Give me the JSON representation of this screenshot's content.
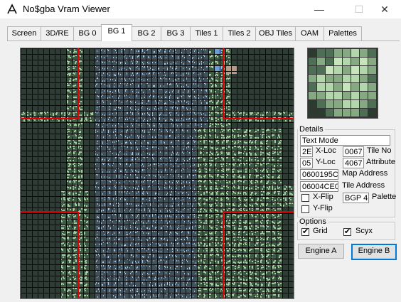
{
  "window": {
    "title": "No$gba Vram Viewer",
    "minimize_glyph": "—",
    "maximize_glyph": "☐",
    "close_glyph": "✕"
  },
  "tabs": [
    {
      "label": "Screen"
    },
    {
      "label": "3D/RE"
    },
    {
      "label": "BG 0"
    },
    {
      "label": "BG 1",
      "active": true
    },
    {
      "label": "BG 2"
    },
    {
      "label": "BG 3"
    },
    {
      "label": "Tiles 1"
    },
    {
      "label": "Tiles 2"
    },
    {
      "label": "OBJ Tiles"
    },
    {
      "label": "OAM"
    },
    {
      "label": "Palettes"
    }
  ],
  "details": {
    "legend": "Details",
    "mode": "Text Mode",
    "x_loc_value": "2E",
    "x_loc_label": "X-Loc",
    "tile_no_value": "0067",
    "tile_no_label": "Tile No",
    "y_loc_value": "05",
    "y_loc_label": "Y-Loc",
    "attribute_value": "4067",
    "attribute_label": "Attribute",
    "map_address_value": "0600195C",
    "map_address_label": "Map Address",
    "tile_address_value": "06004CE0",
    "tile_address_label": "Tile Address",
    "xflip_label": "X-Flip",
    "xflip_checked": false,
    "palette_value": "BGP 4",
    "palette_label": "Palette",
    "yflip_label": "Y-Flip",
    "yflip_checked": false
  },
  "options": {
    "legend": "Options",
    "grid_label": "Grid",
    "grid_checked": true,
    "scyx_label": "Scyx",
    "scyx_checked": true
  },
  "buttons": {
    "engine_a": "Engine A",
    "engine_b": "Engine B"
  },
  "colors": {
    "grid_line": "#0a0a0a",
    "scroll_line": "#e00000",
    "water_light": "#a9c6de",
    "water_dark": "#41515c",
    "foliage_light": "#a8c8a0",
    "foliage_dark": "#3e5a44",
    "bg_dark": "#2e3c36"
  },
  "tile_preview_palette": [
    "#2c3a30",
    "#4f6e56",
    "#86a882",
    "#b4d6ac",
    "#c8e4bc"
  ]
}
